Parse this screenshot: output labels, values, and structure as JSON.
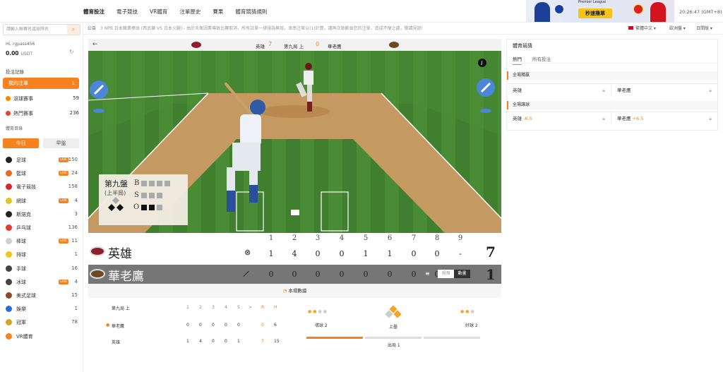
{
  "nav": {
    "items": [
      "體育投注",
      "電子競技",
      "VR體育",
      "注單歷史",
      "賽果",
      "體育競猜規則"
    ]
  },
  "banner": {
    "promo_text": "秒速撸單",
    "league_text": "Premier League"
  },
  "clock": "20:26:47 (GMT+8)",
  "sidebar": {
    "search_placeholder": "請輸入聯賽名或球隊名",
    "username": "Hi, rgpass456",
    "balance": "0.00",
    "currency": "USDT",
    "bet_records": "投注記錄",
    "my_bets": {
      "label": "我的注單",
      "count": "1"
    },
    "featured": [
      {
        "label": "滾球賽事",
        "count": "59"
      },
      {
        "label": "熱門賽事",
        "count": "236"
      }
    ],
    "sports_dir": "體育目錄",
    "tab_today": "今日",
    "tab_early": "早盤",
    "sports": [
      {
        "label": "足球",
        "count": "150",
        "live": true,
        "color": "#222"
      },
      {
        "label": "籃球",
        "count": "24",
        "live": true,
        "color": "#e86b1f"
      },
      {
        "label": "電子競技",
        "count": "158",
        "live": false,
        "color": "#d6262b"
      },
      {
        "label": "網球",
        "count": "4",
        "live": true,
        "color": "#e8c21f"
      },
      {
        "label": "斯諾克",
        "count": "3",
        "live": false,
        "color": "#222"
      },
      {
        "label": "乒乓球",
        "count": "136",
        "live": false,
        "color": "#e23c2c"
      },
      {
        "label": "棒球",
        "count": "11",
        "live": true,
        "color": "#cfcfcf"
      },
      {
        "label": "排球",
        "count": "1",
        "live": false,
        "color": "#f0c419"
      },
      {
        "label": "手球",
        "count": "16",
        "live": false,
        "color": "#444"
      },
      {
        "label": "冰球",
        "count": "4",
        "live": true,
        "color": "#444"
      },
      {
        "label": "美式足球",
        "count": "15",
        "live": false,
        "color": "#8a4b22"
      },
      {
        "label": "娛樂",
        "count": "1",
        "live": false,
        "color": "#2c6bd6"
      },
      {
        "label": "冠軍",
        "count": "78",
        "live": false,
        "color": "#d7a21e"
      },
      {
        "label": "VR體育",
        "count": "",
        "live": false,
        "color": "#f5821f"
      }
    ],
    "live_badge": "LIVE"
  },
  "notice": {
    "label": "公告",
    "text": "3 NPB 日本職業棒球 (西武獅 VS 日本火腿) - 由於天氣因素導致比賽取消，所有註單一律視為無效。滾串注單以(1)計算。謹再次致歉並您的注單，造成不便之處，敬請見諒!"
  },
  "topright": {
    "lang": "繁體中文",
    "odds_type": "歐洲盤",
    "view": "日間版"
  },
  "game": {
    "home": "英雄",
    "away": "華老鷹",
    "home_score": "7",
    "away_score": "0",
    "inning": "第九局 上",
    "overlay_inning": "第九盤",
    "overlay_half": "(上半局)",
    "b_label": "B",
    "s_label": "S",
    "o_label": "O",
    "innings": [
      "1",
      "2",
      "3",
      "4",
      "5",
      "6",
      "7",
      "8",
      "9"
    ],
    "home_line": [
      "1",
      "4",
      "0",
      "0",
      "1",
      "1",
      "0",
      "0",
      "-"
    ],
    "away_line": [
      "0",
      "0",
      "0",
      "0",
      "0",
      "0",
      "0",
      "0",
      ""
    ],
    "home_total": "7",
    "away_total": "1",
    "view_toggle": [
      "視頻",
      "動畫"
    ]
  },
  "stats": {
    "tab": "本場數據",
    "inning_label": "第九局 上",
    "heads": [
      "1",
      "2",
      "3",
      "4",
      "5",
      ">",
      "R",
      "H"
    ],
    "rows": [
      {
        "team": "華老鷹",
        "vals": [
          "0",
          "0",
          "0",
          "0",
          "0"
        ],
        "r": "0",
        "h": "6"
      },
      {
        "team": "英雄",
        "vals": [
          "1",
          "4",
          "0",
          "0",
          "1"
        ],
        "r": "7",
        "h": "15"
      }
    ],
    "balls": "壞球 2",
    "base": "上壘",
    "strikes": "好球 2",
    "outs": "出局 1"
  },
  "right": {
    "title": "體育競猜",
    "tabs": [
      "熱門",
      "所有投注"
    ],
    "moneyline_title": "全場獨贏",
    "handicap_title": "全場讓球",
    "ml": [
      {
        "team": "英雄"
      },
      {
        "team": "華老鷹"
      }
    ],
    "hc": [
      {
        "team": "英雄",
        "line": "-6.5"
      },
      {
        "team": "華老鷹",
        "line": "+6.5"
      }
    ]
  },
  "colors": {
    "accent": "#f5821f",
    "grass": "#3d7a2c",
    "dirt": "#c9a36b"
  }
}
